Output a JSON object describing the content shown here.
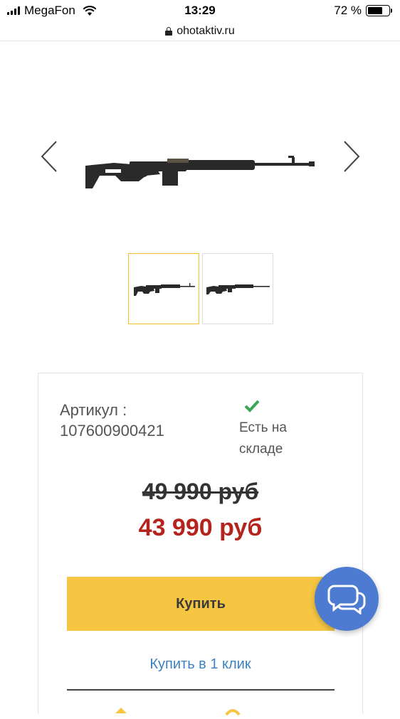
{
  "status_bar": {
    "carrier": "MegaFon",
    "time": "13:29",
    "battery_percent": "72 %",
    "battery_level": 0.72
  },
  "browser": {
    "url": "ohotaktiv.ru"
  },
  "gallery": {
    "prev_icon": "chevron-left-icon",
    "next_icon": "chevron-right-icon",
    "thumbnail_count": 2,
    "active_thumbnail": 0
  },
  "product": {
    "sku_label": "Артикул :",
    "sku_value": "107600900421",
    "stock_text": "Есть на складе",
    "old_price": "49 990 руб",
    "new_price": "43 990 руб",
    "buy_label": "Купить",
    "one_click_label": "Купить в 1 клик"
  },
  "colors": {
    "accent_yellow": "#f6c642",
    "price_red": "#b5231d",
    "link_blue": "#3a82c4",
    "stock_green": "#3aa655",
    "chat_blue": "#4d7bd1"
  }
}
